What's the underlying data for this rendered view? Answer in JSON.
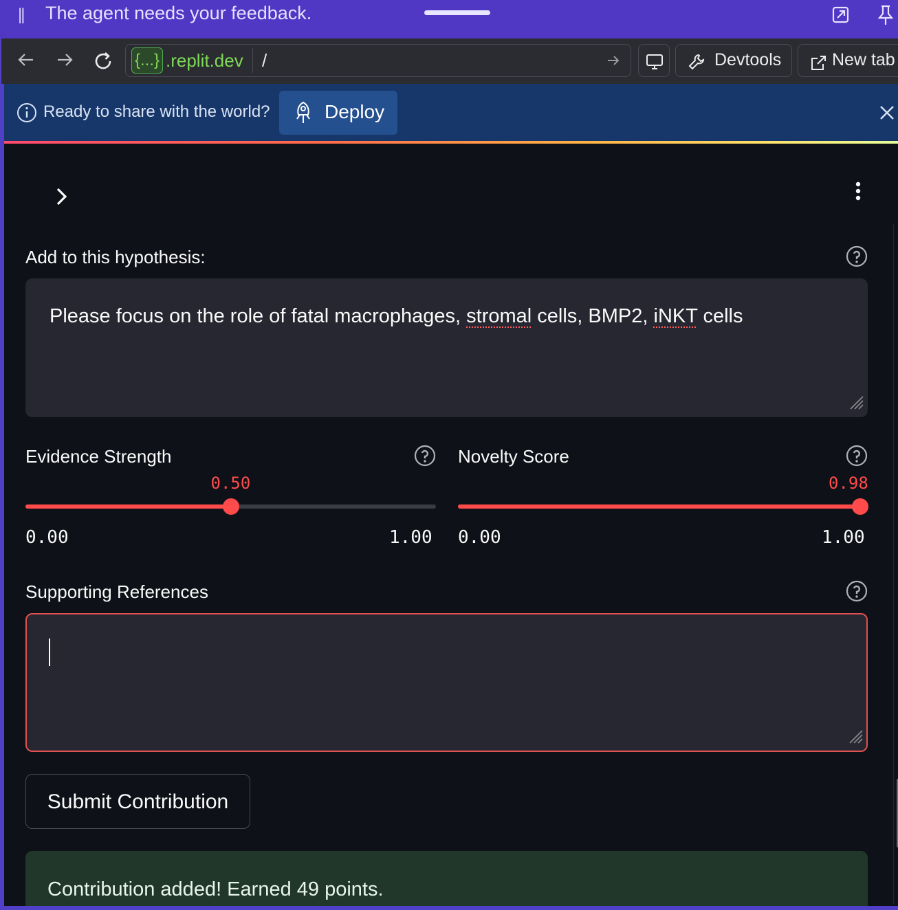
{
  "titlebar": {
    "message": "The agent needs your feedback.",
    "drag_glyph": "||",
    "icons": [
      "popout-icon",
      "pin-icon"
    ]
  },
  "browser": {
    "host_badge": "{...}",
    "host": ".replit.dev",
    "path": "/",
    "devtools_label": "Devtools",
    "newtab_label": "New tab",
    "icons": [
      "back-arrow-icon",
      "forward-arrow-icon",
      "reload-icon",
      "go-arrow-icon",
      "monitor-icon",
      "wrench-icon",
      "external-link-icon"
    ]
  },
  "banner": {
    "text": "Ready to share with the world?",
    "deploy_label": "Deploy",
    "icons": [
      "info-icon",
      "rocket-icon",
      "close-icon"
    ]
  },
  "app": {
    "hypothesis": {
      "label": "Add to this hypothesis:",
      "value_before": "Please focus on the role of fatal macrophages, ",
      "value_misspelled_1": "stromal",
      "value_middle": " cells, BMP2, ",
      "value_misspelled_2": "iNKT",
      "value_after": " cells"
    },
    "evidence": {
      "label": "Evidence Strength",
      "value_text": "0.50",
      "value": 0.5,
      "min_text": "0.00",
      "max_text": "1.00"
    },
    "novelty": {
      "label": "Novelty Score",
      "value_text": "0.98",
      "value": 0.98,
      "min_text": "0.00",
      "max_text": "1.00"
    },
    "references": {
      "label": "Supporting References",
      "value": ""
    },
    "submit_label": "Submit Contribution",
    "success_message": "Contribution added! Earned 49 points."
  },
  "colors": {
    "accent": "#ff4b4b",
    "titlebar": "#5038c4",
    "banner": "#17376b",
    "app_bg": "#0e1117",
    "input_bg": "#262730",
    "success_bg": "#21372a"
  }
}
